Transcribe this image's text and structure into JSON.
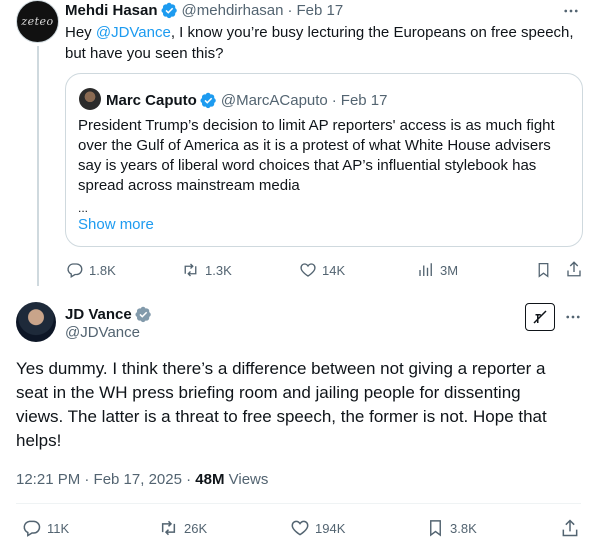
{
  "parent_tweet": {
    "author_name": "Mehdi Hasan",
    "handle": "@mehdirhasan",
    "separator": "·",
    "date": "Feb 17",
    "avatar_text": "zeteo",
    "text_prefix": "Hey ",
    "mention": "@JDVance",
    "text_line1_rest": ", I know you’re busy lecturing the Europeans on free speech,",
    "text_line2": "but have you seen this?",
    "more_icon": "more-dots-icon",
    "quote": {
      "author_name": "Marc Caputo",
      "handle": "@MarcACaputo",
      "separator": "·",
      "date": "Feb 17",
      "lines": [
        "President Trump’s decision to limit AP reporters' access is as much fight",
        "over the Gulf of America as it is a protest of what White House advisers",
        "say is years of liberal word choices that AP’s influential stylebook has",
        "spread across mainstream media"
      ],
      "ellipsis": "...",
      "show_more": "Show more"
    },
    "actions": {
      "replies": "1.8K",
      "reposts": "1.3K",
      "likes": "14K",
      "views": "3M"
    }
  },
  "main_tweet": {
    "author_name": "JD Vance",
    "handle": "@JDVance",
    "more_icon": "more-dots-icon",
    "grok_icon": "grok-icon",
    "text_lines": [
      "Yes dummy. I think there’s a difference between not giving a reporter a",
      "seat in the WH press briefing room and jailing people for dissenting",
      "views. The latter is a threat to free speech, the former is not. Hope that",
      "helps!"
    ],
    "time": "12:21 PM · Feb 17, 2025 · ",
    "views_count": "48M",
    "views_label": " Views",
    "actions": {
      "replies": "11K",
      "reposts": "26K",
      "likes": "194K",
      "bookmarks": "3.8K"
    }
  },
  "colors": {
    "accent": "#1d9bf0",
    "text": "#0f1419",
    "muted": "#536471",
    "border": "#cfd9de"
  }
}
